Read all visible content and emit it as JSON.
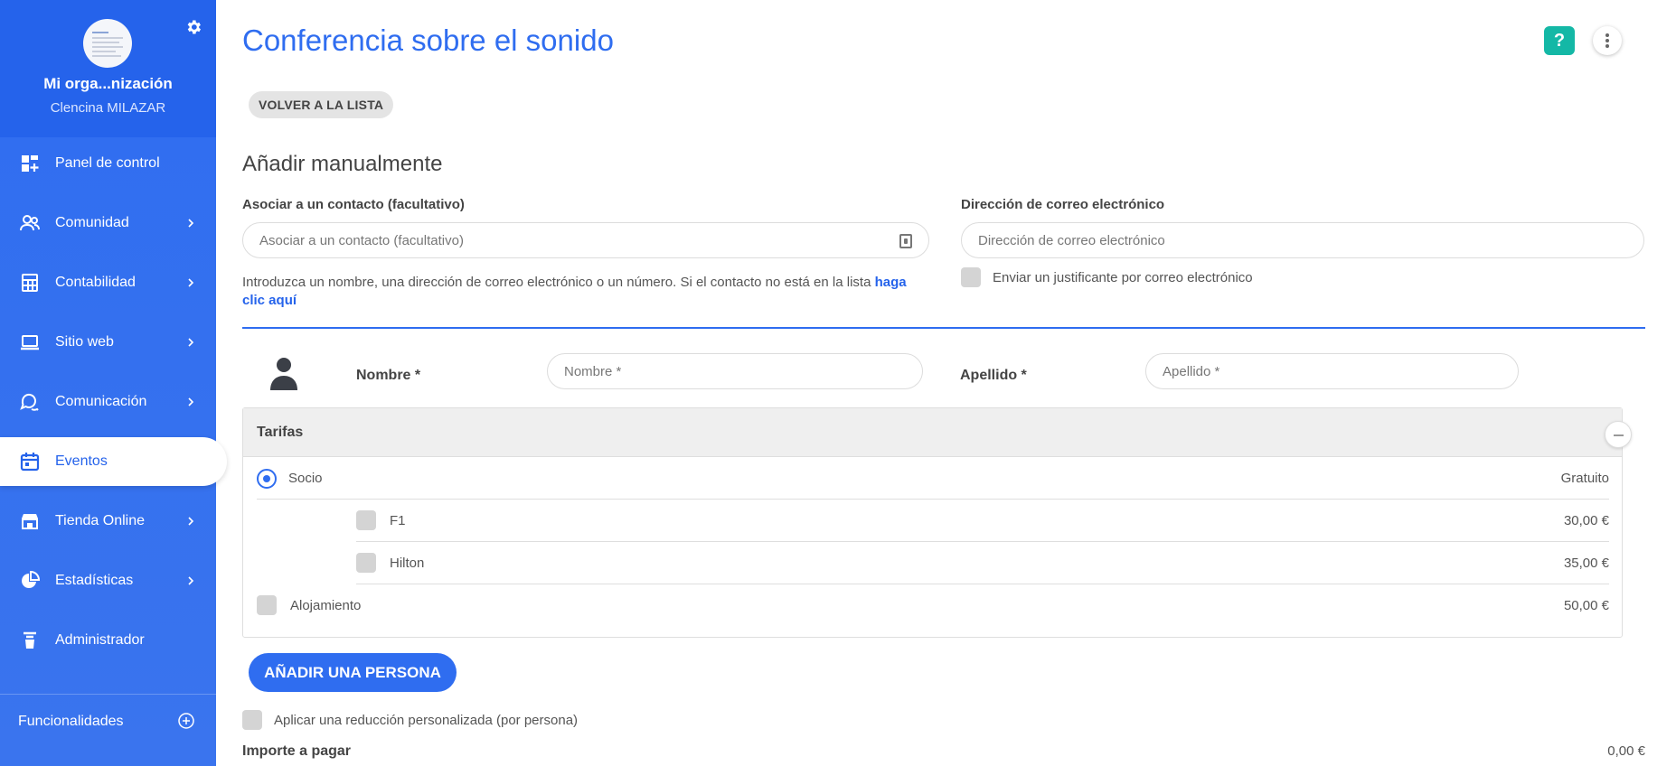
{
  "sidebar": {
    "org_name": "Mi orga...nización",
    "user_name": "Clencina MILAZAR",
    "items": [
      {
        "label": "Panel de control",
        "icon": "dashboard-icon",
        "has_chevron": false
      },
      {
        "label": "Comunidad",
        "icon": "users-icon",
        "has_chevron": true
      },
      {
        "label": "Contabilidad",
        "icon": "calculator-icon",
        "has_chevron": true
      },
      {
        "label": "Sitio web",
        "icon": "laptop-icon",
        "has_chevron": true
      },
      {
        "label": "Comunicación",
        "icon": "chat-icon",
        "has_chevron": true
      },
      {
        "label": "Eventos",
        "icon": "calendar-icon",
        "has_chevron": false,
        "active": true
      },
      {
        "label": "Tienda Online",
        "icon": "store-icon",
        "has_chevron": true
      },
      {
        "label": "Estadísticas",
        "icon": "pie-chart-icon",
        "has_chevron": true
      },
      {
        "label": "Administrador",
        "icon": "admin-icon",
        "has_chevron": false
      }
    ],
    "footer_label": "Funcionalidades"
  },
  "header": {
    "title": "Conferencia sobre el sonido",
    "help_label": "?",
    "back_label": "VOLVER A LA LISTA"
  },
  "form": {
    "section_title": "Añadir manualmente",
    "contact_label": "Asociar a un contacto (facultativo)",
    "contact_placeholder": "Asociar a un contacto (facultativo)",
    "contact_help": "Introduzca un nombre, una dirección de correo electrónico o un número. Si el contacto no está en la lista",
    "contact_help_link": "haga clic aquí",
    "email_label": "Dirección de correo electrónico",
    "email_placeholder": "Dirección de correo electrónico",
    "send_receipt_label": "Enviar un justificante por correo electrónico",
    "first_name_label": "Nombre *",
    "first_name_placeholder": "Nombre *",
    "last_name_label": "Apellido *",
    "last_name_placeholder": "Apellido *"
  },
  "rates": {
    "title": "Tarifas",
    "items": [
      {
        "name": "Socio",
        "price": "Gratuito",
        "control": "radio",
        "selected": true
      },
      {
        "name": "F1",
        "price": "30,00 €",
        "control": "checkbox",
        "checked": false
      },
      {
        "name": "Hilton",
        "price": "35,00 €",
        "control": "checkbox",
        "checked": false
      },
      {
        "name": "Alojamiento",
        "price": "50,00 €",
        "control": "checkbox",
        "checked": false
      }
    ]
  },
  "actions": {
    "add_person_label": "AÑADIR UNA PERSONA",
    "discount_label": "Aplicar una reducción personalizada (por persona)"
  },
  "total": {
    "label": "Importe a pagar",
    "value": "0,00 €"
  },
  "colors": {
    "primary": "#2f6df0",
    "sidebar": "#2f6df0",
    "help_button": "#14b8a6"
  }
}
